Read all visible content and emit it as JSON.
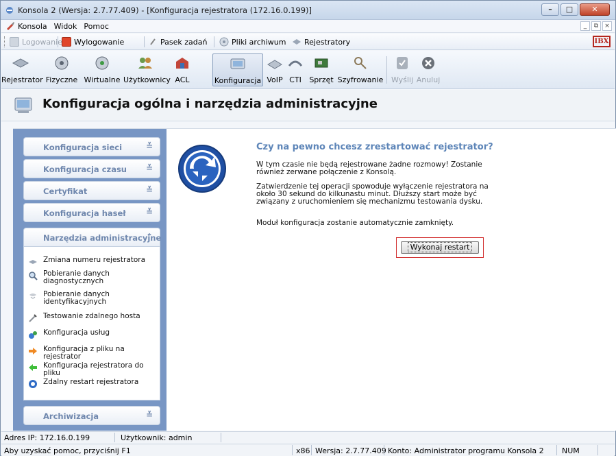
{
  "window": {
    "title": "Konsola 2 (Wersja:  2.7.77.409) - [Konfiguracja rejestratora (172.16.0.199)]",
    "controls": {
      "minimize": "–",
      "maximize": "□",
      "close": "✕"
    }
  },
  "menubar": {
    "items": [
      "Konsola",
      "Widok",
      "Pomoc"
    ],
    "mdi_controls": [
      "_",
      "⧉",
      "×"
    ]
  },
  "quickbar": {
    "items": [
      {
        "label": "Logowanie",
        "enabled": false,
        "icon": "login-icon"
      },
      {
        "label": "Wylogowanie",
        "enabled": true,
        "icon": "logout-icon"
      },
      {
        "label": "Pasek zadań",
        "enabled": true,
        "icon": "paperclip-icon"
      },
      {
        "label": "Pliki archiwum",
        "enabled": true,
        "icon": "archive-files-icon"
      },
      {
        "label": "Rejestratory",
        "enabled": true,
        "icon": "recorders-icon"
      }
    ],
    "logo": "IBX"
  },
  "toolbar": {
    "items": [
      {
        "label": "Rejestrator",
        "icon": "recorder-icon"
      },
      {
        "label": "Fizyczne",
        "icon": "physical-channels-icon"
      },
      {
        "label": "Wirtualne",
        "icon": "virtual-channels-icon"
      },
      {
        "label": "Użytkownicy",
        "icon": "users-icon"
      },
      {
        "label": "ACL",
        "icon": "acl-icon"
      },
      {
        "label": "Konfiguracja",
        "icon": "configuration-icon",
        "active": true
      },
      {
        "label": "VoIP",
        "icon": "voip-icon"
      },
      {
        "label": "CTI",
        "icon": "cti-icon"
      },
      {
        "label": "Sprzęt",
        "icon": "hardware-icon"
      },
      {
        "label": "Szyfrowanie",
        "icon": "encryption-icon"
      },
      {
        "label": "Wyślij",
        "icon": "send-icon",
        "enabled": false
      },
      {
        "label": "Anuluj",
        "icon": "cancel-icon",
        "enabled": false
      }
    ]
  },
  "page": {
    "title": "Konfiguracja ogólna i narzędzia administracyjne"
  },
  "sidebar": {
    "sections": [
      {
        "label": "Konfiguracja sieci",
        "chevron": "≚"
      },
      {
        "label": "Konfiguracja czasu",
        "chevron": "≚"
      },
      {
        "label": "Certyfikat",
        "chevron": "≚"
      },
      {
        "label": "Konfiguracja haseł",
        "chevron": "≚"
      },
      {
        "label": "Narzędzia administracyjne",
        "chevron": "⌃",
        "expanded": true
      },
      {
        "label": "Archiwizacja",
        "chevron": "≚"
      }
    ],
    "tools": [
      {
        "label": "Zmiana numeru rejestratora",
        "icon": "renumber-icon"
      },
      {
        "label": "Pobieranie danych diagnostycznych",
        "icon": "magnifier-icon"
      },
      {
        "label": "Pobieranie danych identyfikacyjnych",
        "icon": "identification-icon"
      },
      {
        "label": "Testowanie zdalnego hosta",
        "icon": "test-host-icon"
      },
      {
        "label": "Konfiguracja usług",
        "icon": "services-icon"
      },
      {
        "label": "Konfiguracja z pliku na rejestrator",
        "icon": "arrow-right-icon"
      },
      {
        "label": "Konfiguracja rejestratora do pliku",
        "icon": "arrow-left-icon"
      },
      {
        "label": "Zdalny restart rejestratora",
        "icon": "restart-icon"
      }
    ]
  },
  "main": {
    "question": "Czy na pewno chcesz zrestartować rejestrator?",
    "paragraph1": "W tym czasie nie będą rejestrowane żadne rozmowy! Zostanie również zerwane połączenie z Konsolą.",
    "paragraph2": "Zatwierdzenie tej operacji spowoduje wyłączenie rejestratora na około 30 sekund do kilkunastu minut. Dłuższy start może być związany z uruchomieniem się mechanizmu testowania dysku.",
    "paragraph3": "Moduł konfiguracja zostanie automatycznie zamknięty.",
    "restart_button": "Wykonaj restart"
  },
  "status": {
    "ip": "Adres IP: 172.16.0.199",
    "user": "Użytkownik: admin",
    "help": "Aby uzyskać pomoc, przyciśnij F1",
    "arch": "x86",
    "version": "Wersja: 2.7.77.409",
    "account": "Konto: Administrator programu Konsola 2",
    "num": "NUM"
  },
  "colors": {
    "sidebar_bg": "#7896c4",
    "accent_title": "#5d85b8",
    "highlight_border": "#d23232"
  }
}
